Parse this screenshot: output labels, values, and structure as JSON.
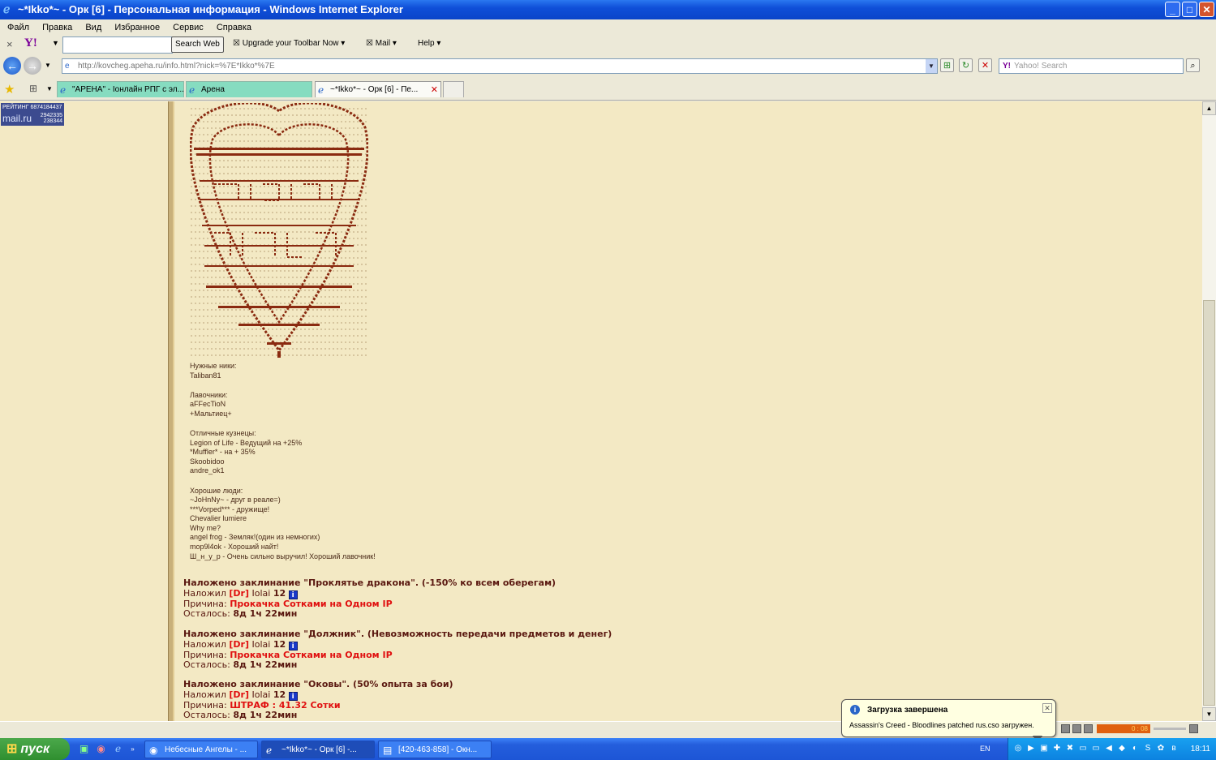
{
  "window": {
    "title": "~*Ikko*~ - Орк [6] - Персональная информация - Windows Internet Explorer",
    "btn_min": "_",
    "btn_max": "□",
    "btn_close": "✕"
  },
  "menu": [
    "Файл",
    "Правка",
    "Вид",
    "Избранное",
    "Сервис",
    "Справка"
  ],
  "yahoo_toolbar": {
    "close": "×",
    "logo": "Y!",
    "search_value": "",
    "search_button": "Search Web",
    "upgrade": "Upgrade your Toolbar Now",
    "mail": "Mail",
    "help": "Help"
  },
  "address": {
    "url": "http://kovcheg.apeha.ru/info.html?nick=%7E*Ikko*%7E",
    "search_placeholder": "Yahoo! Search"
  },
  "tabs": [
    {
      "label": "\"АРЕНА\" - Iонлайн РПГ с эл...",
      "active": false
    },
    {
      "label": "Арена",
      "active": false
    },
    {
      "label": "~*Ikko*~ - Орк [6] - Пе...",
      "active": true
    }
  ],
  "mailru": {
    "line1": "РЕЙТИНГ 6874184437",
    "logo": "mail.ru",
    "n2": "2942335",
    "n3": "238344"
  },
  "profile": {
    "needed_nicks_title": "Нужные ники:",
    "needed_nicks": [
      "Taliban81"
    ],
    "shopkeepers_title": "Лавочники:",
    "shopkeepers": [
      "aFFecTioN",
      "+Мальтиец+"
    ],
    "smiths_title": "Отличные кузнецы:",
    "smiths": [
      "Legion of Life - Ведущий на +25%",
      "*Muffler* - на + 35%",
      "Skoobidoo",
      "andre_ok1"
    ],
    "good_people_title": "Хорошие люди:",
    "good_people": [
      "~JoHnNy~ - друг в реале=)",
      "***Vorped*** - дружище!",
      "Chevalier lumiere",
      "Why me?",
      "angel frog - Земляк!(один из немногих)",
      "mop9l4ok - Хороший найт!",
      "Ш_н_у_р - Очень сильно выручил! Хороший лавочник!"
    ]
  },
  "spells": [
    {
      "title": "Наложено заклинание \"Проклятье дракона\". (-150% ко всем оберегам)",
      "by_label": "Наложил",
      "clan": "[Dr]",
      "caster": "Iolai",
      "level": "12",
      "reason_label": "Причина:",
      "reason": "Прокачка Сотками на Одном IP",
      "left_label": "Осталось:",
      "left": "8д 1ч 22мин"
    },
    {
      "title": "Наложено заклинание \"Должник\". (Невозможность передачи предметов и денег)",
      "by_label": "Наложил",
      "clan": "[Dr]",
      "caster": "Iolai",
      "level": "12",
      "reason_label": "Причина:",
      "reason": "Прокачка Сотками на Одном IP",
      "left_label": "Осталось:",
      "left": "8д 1ч 22мин"
    },
    {
      "title": "Наложено заклинание \"Оковы\". (50% опыта за бои)",
      "by_label": "Наложил",
      "clan": "[Dr]",
      "caster": "Iolai",
      "level": "12",
      "reason_label": "Причина:",
      "reason": "ШТРАФ : 41.32 Сотки",
      "left_label": "Осталось:",
      "left": "8д 1ч 22мин"
    }
  ],
  "balloon": {
    "title": "Загрузка завершена",
    "message": "Assassin's Creed - Bloodlines patched rus.cso загружен."
  },
  "media_time": "0 : 08",
  "taskbar": {
    "start": "пуск",
    "buttons": [
      {
        "label": "Небесные Ангелы - ...",
        "active": false
      },
      {
        "label": "~*Ikko*~ - Орк [6] -...",
        "active": true
      },
      {
        "label": "[420-463-858] - Окн...",
        "active": false
      }
    ],
    "lang": "EN",
    "clock": "18:11"
  },
  "colors": {
    "page_bg": "#F3E9C4",
    "spell_title": "#5A1810",
    "reason_red": "#E01010",
    "art": "#8A2A10",
    "titlebar": "#0F4FD8"
  }
}
